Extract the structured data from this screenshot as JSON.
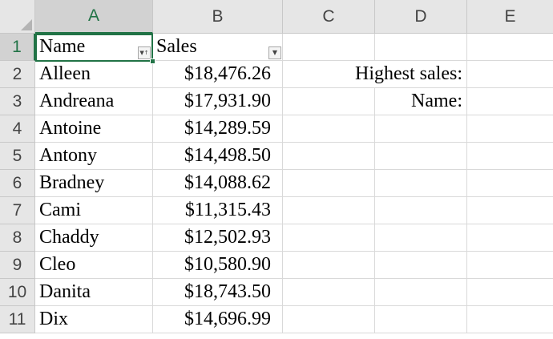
{
  "columns": [
    "A",
    "B",
    "C",
    "D",
    "E"
  ],
  "active_column": "A",
  "rows": [
    "1",
    "2",
    "3",
    "4",
    "5",
    "6",
    "7",
    "8",
    "9",
    "10",
    "11"
  ],
  "active_row": "1",
  "headers": {
    "name": "Name",
    "sales": "Sales"
  },
  "data": [
    {
      "name": "Alleen",
      "sales": "$18,476.26"
    },
    {
      "name": "Andreana",
      "sales": "$17,931.90"
    },
    {
      "name": "Antoine",
      "sales": "$14,289.59"
    },
    {
      "name": "Antony",
      "sales": "$14,498.50"
    },
    {
      "name": "Bradney",
      "sales": "$14,088.62"
    },
    {
      "name": "Cami",
      "sales": "$11,315.43"
    },
    {
      "name": "Chaddy",
      "sales": "$12,502.93"
    },
    {
      "name": "Cleo",
      "sales": "$10,580.90"
    },
    {
      "name": "Danita",
      "sales": "$18,743.50"
    },
    {
      "name": "Dix",
      "sales": "$14,696.99"
    }
  ],
  "labels": {
    "highest_sales": "Highest sales:",
    "name": "Name:"
  },
  "icons": {
    "sort_filter_active": "sort-filter-icon",
    "filter": "filter-dropdown-icon"
  },
  "colors": {
    "accent": "#217346",
    "header_bg": "#e6e6e6",
    "gridline": "#d9d9d9"
  }
}
